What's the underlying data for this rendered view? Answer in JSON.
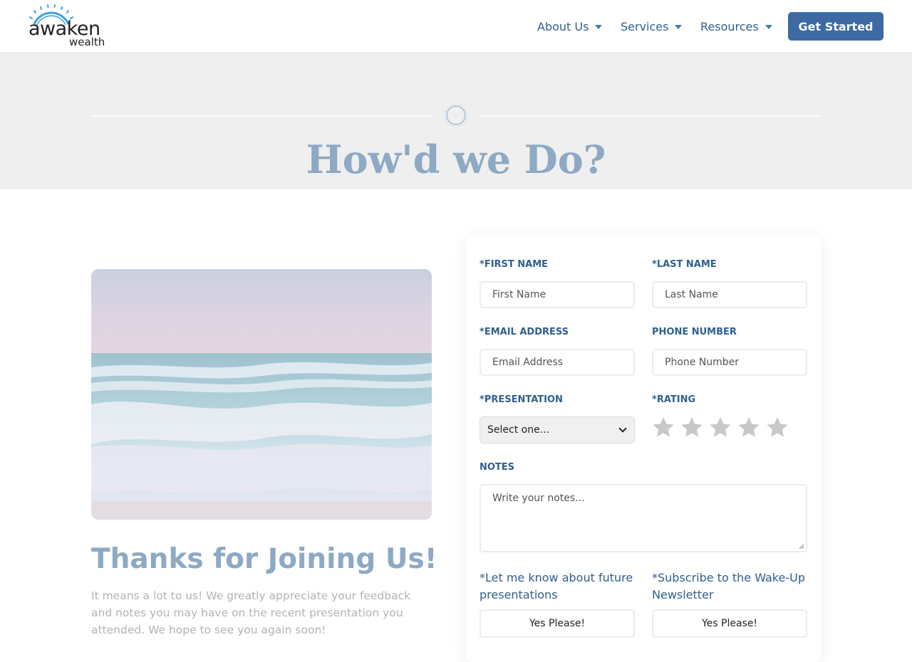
{
  "brand": {
    "name": "awaken",
    "sub": "wealth"
  },
  "nav": {
    "items": [
      {
        "label": "About Us"
      },
      {
        "label": "Services"
      },
      {
        "label": "Resources"
      }
    ],
    "cta_label": "Get Started"
  },
  "hero": {
    "title": "How'd we Do?"
  },
  "intro": {
    "title": "Thanks for Joining Us!",
    "body": "It means a lot to us! We greatly appreciate your feedback and notes you may have on the recent presentation you attended. We hope to see you again soon!"
  },
  "form": {
    "required_mark": "*",
    "first_name": {
      "label": "FIRST NAME",
      "placeholder": "First Name"
    },
    "last_name": {
      "label": "LAST NAME",
      "placeholder": "Last Name"
    },
    "email": {
      "label": "EMAIL ADDRESS",
      "placeholder": "Email Address"
    },
    "phone": {
      "label": "PHONE NUMBER",
      "placeholder": "Phone Number"
    },
    "presentation": {
      "label": "PRESENTATION",
      "selected": "Select one..."
    },
    "rating": {
      "label": "RATING",
      "max": 5,
      "value": 0,
      "star_color": "#c8c8c8"
    },
    "notes": {
      "label": "NOTES",
      "placeholder": "Write your notes..."
    },
    "future": {
      "label": "Let me know about future presentations",
      "button": "Yes Please!"
    },
    "newsletter": {
      "label": "Subscribe to the Wake-Up Newsletter",
      "button": "Yes Please!"
    }
  },
  "colors": {
    "accent": "#3d6aa3",
    "label": "#2f5f8e",
    "hero_title": "#8ea9c3",
    "hero_bg": "#efefef"
  }
}
